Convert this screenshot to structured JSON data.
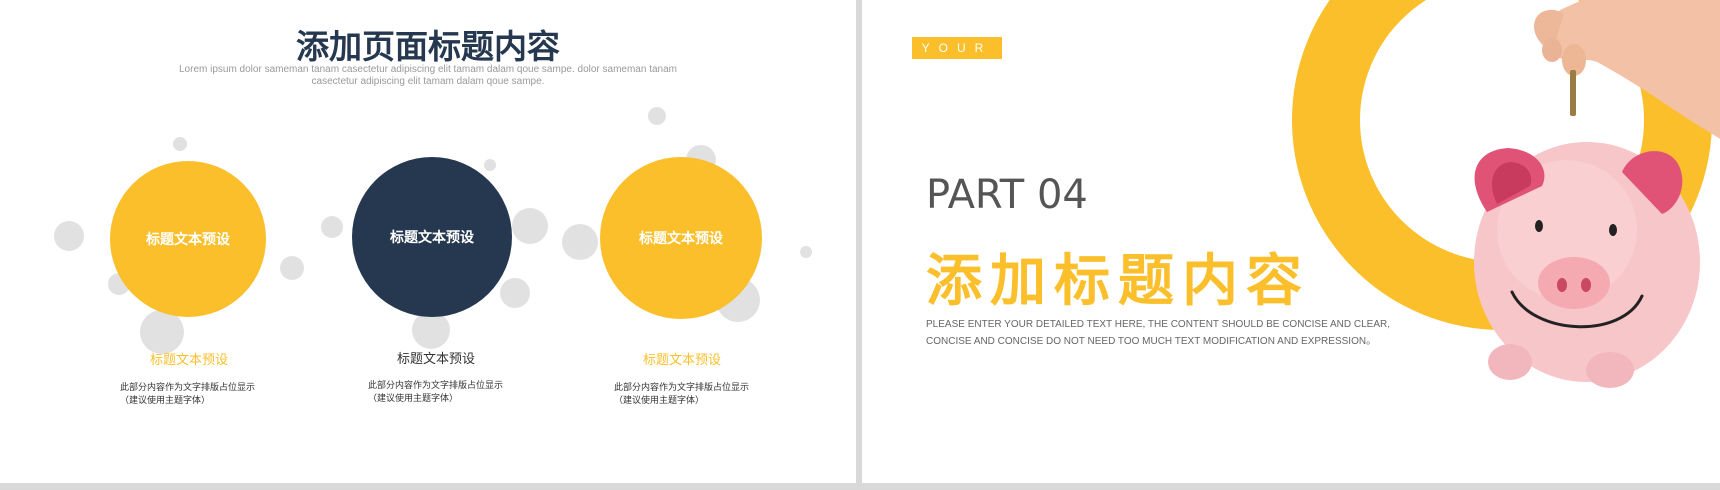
{
  "left_slide": {
    "title": "添加页面标题内容",
    "subtitle_lines": [
      "Lorem ipsum dolor sameman tanam casectetur adipiscing elit tamam dalam qoue sampe. dolor sameman tanam",
      "casectetur adipiscing elit tamam dalam qoue sampe."
    ],
    "columns": [
      {
        "circle_text": "标题文本预设",
        "label": "标题文本预设",
        "desc_lines": [
          "此部分内容作为文字排版占位显示",
          "（建议使用主题字体）"
        ]
      },
      {
        "circle_text": "标题文本预设",
        "label": "标题文本预设",
        "desc_lines": [
          "此部分内容作为文字排版占位显示",
          "（建议使用主题字体）"
        ]
      },
      {
        "circle_text": "标题文本预设",
        "label": "标题文本预设",
        "desc_lines": [
          "此部分内容作为文字排版占位显示",
          "（建议使用主题字体）"
        ]
      }
    ]
  },
  "right_slide": {
    "badge": "YOUR",
    "part": "PART 04",
    "title": "添加标题内容",
    "body_lines": [
      "PLEASE ENTER YOUR DETAILED TEXT HERE, THE CONTENT SHOULD BE CONCISE AND CLEAR,",
      "CONCISE AND CONCISE DO NOT NEED TOO MUCH TEXT MODIFICATION AND EXPRESSION。"
    ]
  },
  "colors": {
    "accent": "#fbbf2b",
    "navy": "#263850",
    "piggy_pink": "#f7c6c9"
  },
  "icons": [
    "piggy-bank-illustration",
    "hand-holding-coin"
  ]
}
